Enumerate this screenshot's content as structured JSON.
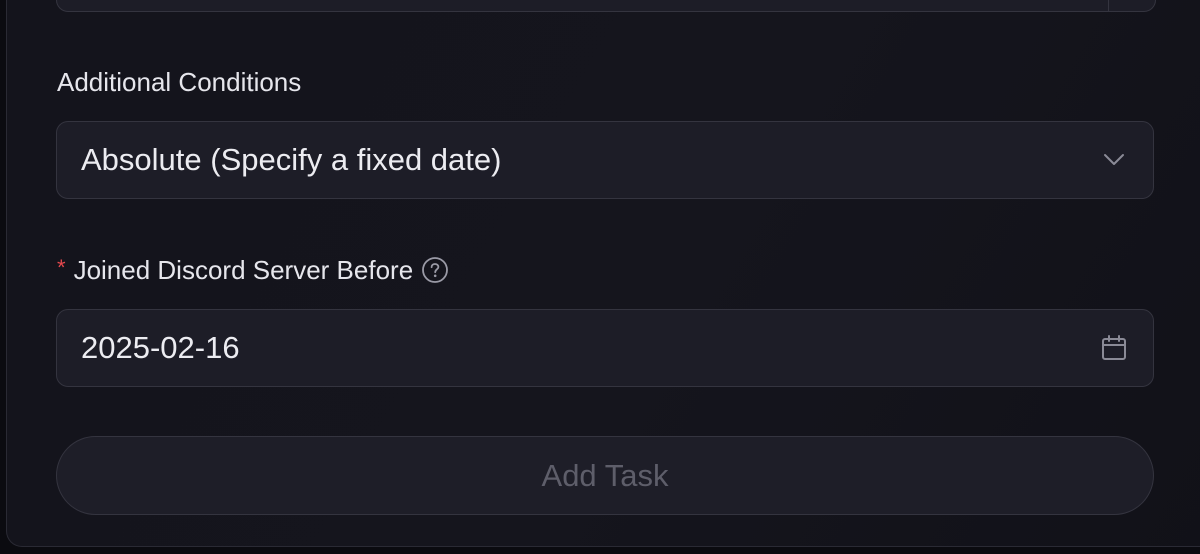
{
  "form": {
    "conditions_label": "Additional Conditions",
    "conditions_select": {
      "value": "Absolute (Specify a fixed date)",
      "icon": "chevron-down-icon"
    },
    "joined_field": {
      "required_mark": "*",
      "label": "Joined Discord Server Before",
      "help_icon": "question-circle-icon",
      "value": "2025-02-16",
      "icon": "calendar-icon"
    },
    "submit": {
      "label": "Add Task",
      "disabled": true
    }
  },
  "colors": {
    "background": "#14141c",
    "field_bg": "#1d1d27",
    "border": "#34343f",
    "text": "#e6e6ec",
    "required": "#e5484d",
    "disabled_text": "#5e5e6a"
  }
}
